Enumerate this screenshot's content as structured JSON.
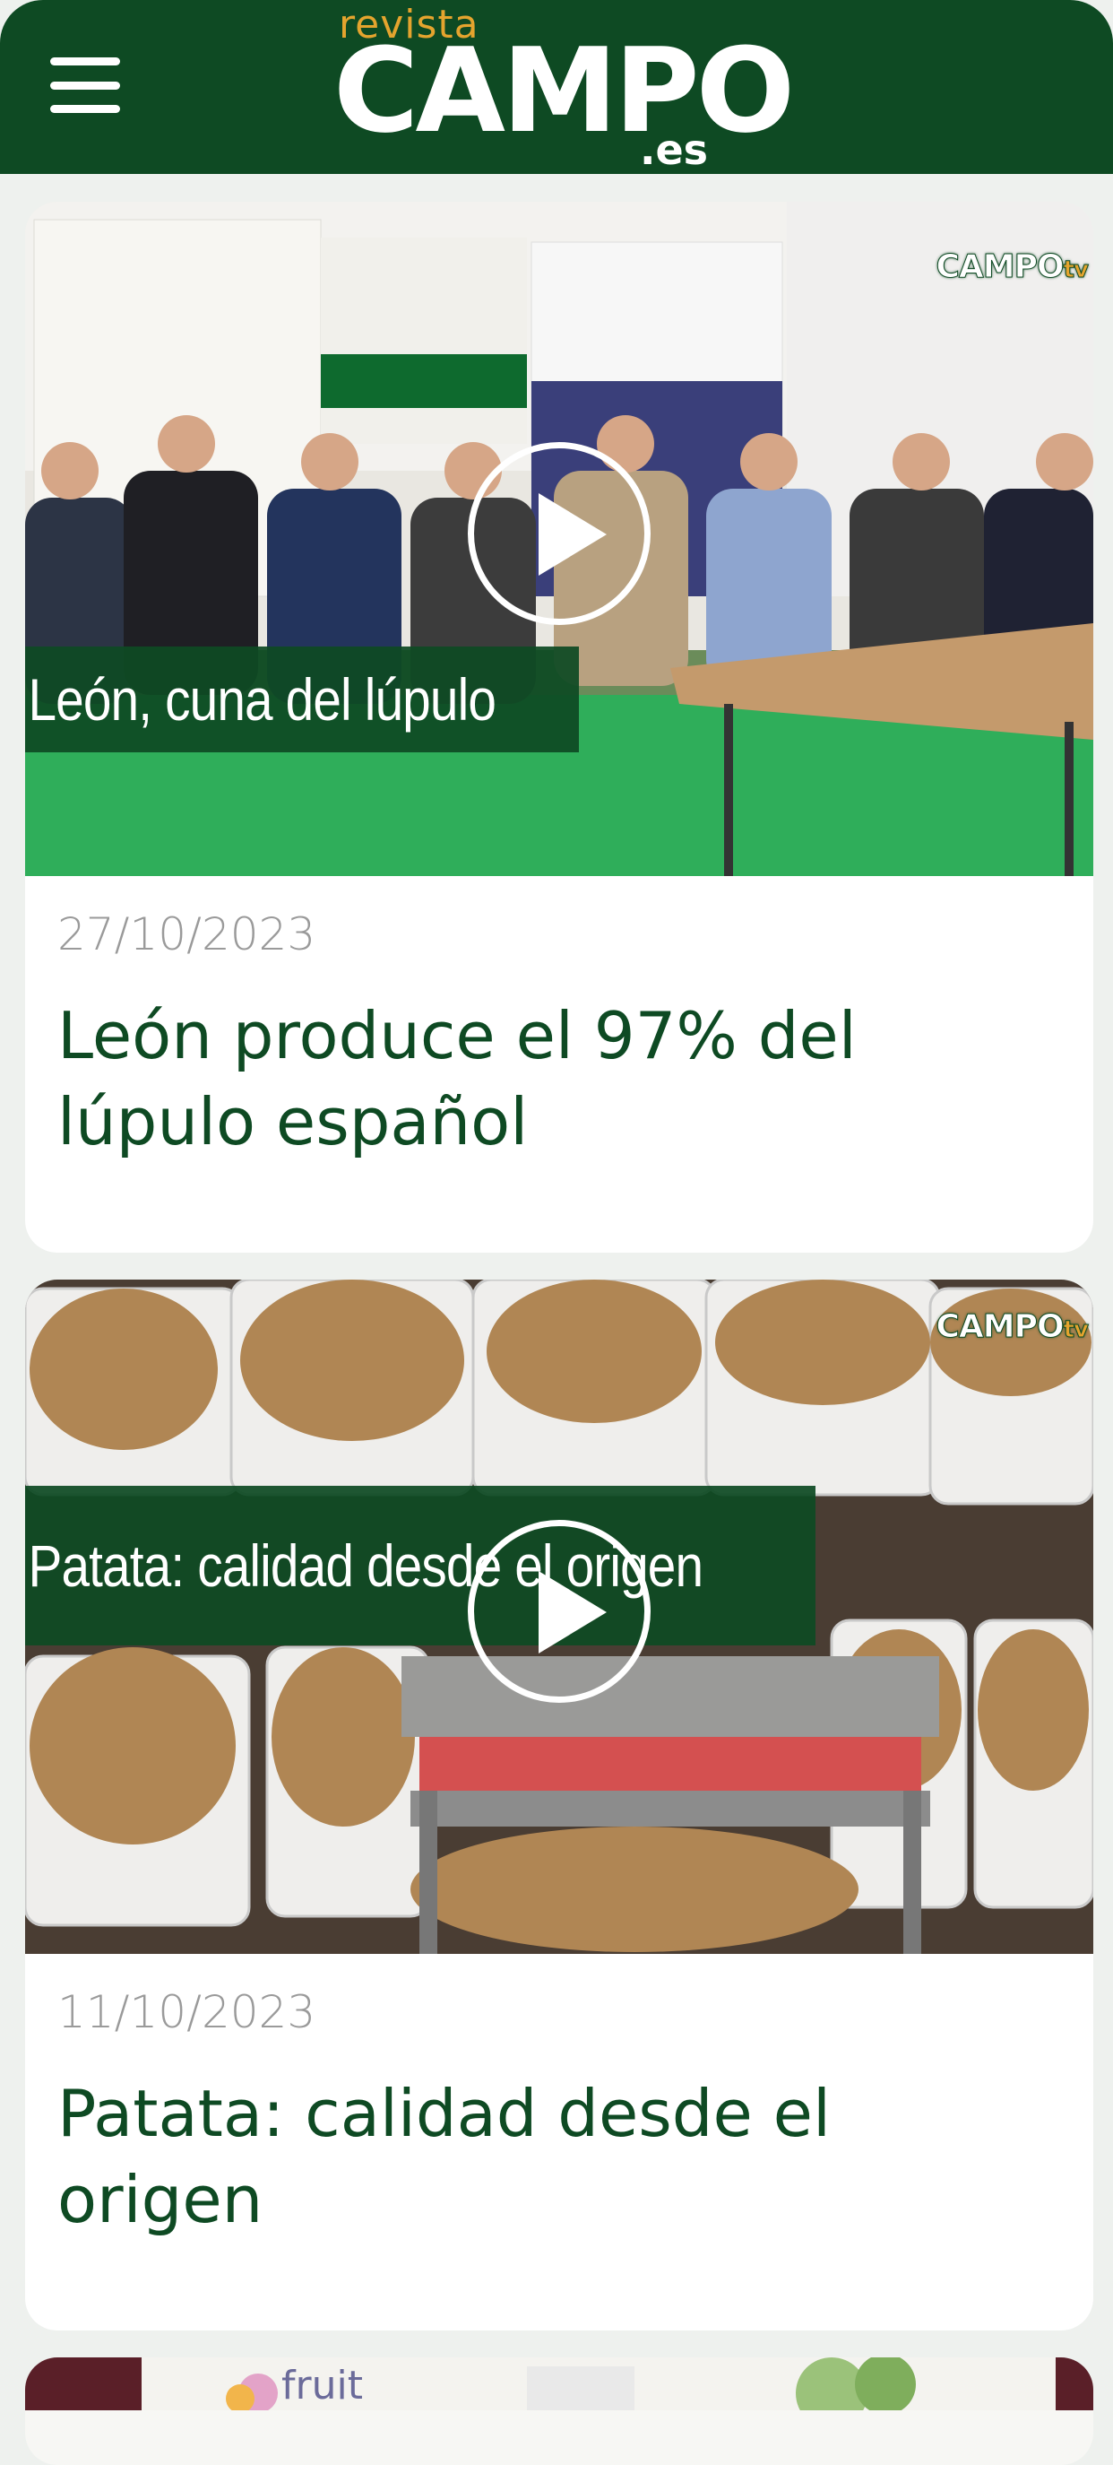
{
  "header": {
    "menu_icon": "hamburger-menu-icon",
    "logo_top": "revista",
    "logo_main": "CAMPO",
    "logo_tld": ".es",
    "background": "#0e4a23",
    "accent": "#e4a42e"
  },
  "articles": [
    {
      "video_title": "León, cuna del lúpulo",
      "watermark": "CAMPO",
      "watermark_suffix": "tv",
      "play_icon": "play-icon",
      "date": "27/10/2023",
      "headline": "León produce el 97% del lúpulo español"
    },
    {
      "video_title": "Patata: calidad desde el origen",
      "watermark": "CAMPO",
      "watermark_suffix": "tv",
      "play_icon": "play-icon",
      "date": "11/10/2023",
      "headline": "Patata: calidad desde el origen"
    },
    {
      "partial_text": "fruit"
    }
  ]
}
